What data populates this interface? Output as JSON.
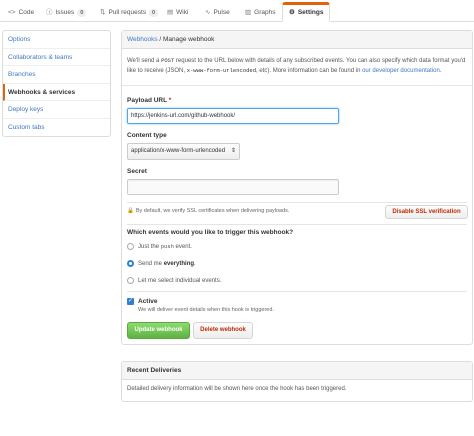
{
  "tabs": [
    {
      "icon": "<>",
      "label": "Code",
      "count": null
    },
    {
      "icon": "ⓘ",
      "label": "Issues",
      "count": "0"
    },
    {
      "icon": "⇅",
      "label": "Pull requests",
      "count": "0"
    },
    {
      "icon": "▤",
      "label": "Wiki",
      "count": null
    },
    {
      "icon": "∿",
      "label": "Pulse",
      "count": null
    },
    {
      "icon": "▥",
      "label": "Graphs",
      "count": null
    },
    {
      "icon": "⚙",
      "label": "Settings",
      "count": null
    }
  ],
  "sidebar": {
    "items": [
      {
        "label": "Options"
      },
      {
        "label": "Collaborators & teams"
      },
      {
        "label": "Branches"
      },
      {
        "label": "Webhooks & services"
      },
      {
        "label": "Deploy keys"
      },
      {
        "label": "Custom tabs"
      }
    ]
  },
  "panel": {
    "breadcrumb_link": "Webhooks",
    "breadcrumb_sep": " / ",
    "breadcrumb_current": "Manage webhook",
    "desc_1": "We'll send a ",
    "desc_code_1": "POST",
    "desc_2": " request to the URL below with details of any subscribed events. You can also specify which data format you'd like to receive (JSON, ",
    "desc_code_2": "x-www-form-urlencoded",
    "desc_3": ", ",
    "desc_etc": "etc",
    "desc_4": "). More information can be found in ",
    "desc_link": "our developer documentation",
    "desc_5": "."
  },
  "form": {
    "payload_label": "Payload URL",
    "payload_required": "*",
    "payload_value": "https://jenkins-url.com/github-webhook/",
    "content_type_label": "Content type",
    "content_type_value": "application/x-www-form-urlencoded",
    "secret_label": "Secret",
    "secret_value": "",
    "ssl_note": "By default, we verify SSL certificates when delivering payloads.",
    "ssl_button": "Disable SSL verification",
    "events_label": "Which events would you like to trigger this webhook?",
    "event_push_prefix": "Just the ",
    "event_push_code": "push",
    "event_push_suffix": " event.",
    "event_everything_prefix": "Send me ",
    "event_everything_strong": "everything",
    "event_everything_suffix": ".",
    "event_individual": "Let me select individual events.",
    "active_label": "Active",
    "active_note": "We will deliver event details when this hook is triggered.",
    "update_button": "Update webhook",
    "delete_button": "Delete webhook"
  },
  "deliveries": {
    "title": "Recent Deliveries",
    "empty_text": "Detailed delivery information will be shown here once the hook has been triggered."
  },
  "colors": {
    "accent": "#4078c0",
    "selected_tab_border": "#e36209",
    "sidebar_selected_border": "#d26911",
    "danger": "#bd2c00",
    "primary_green": "#60b044"
  }
}
